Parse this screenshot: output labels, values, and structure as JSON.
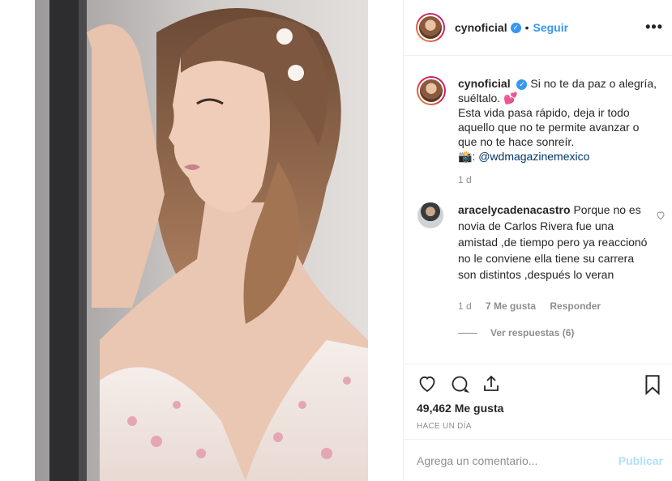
{
  "header": {
    "username": "cynoficial",
    "separator": "•",
    "follow_label": "Seguir",
    "more_icon": "more-horizontal-icon"
  },
  "caption": {
    "username": "cynoficial",
    "line1": "Si no te da paz o alegría, suéltalo.",
    "emoji": "💕",
    "line2": "Esta vida pasa rápido, deja ir todo aquello que no te permite avanzar o que no te hace sonreír.",
    "camera_emoji": "📸",
    "credit_prefix": ": ",
    "credit_handle": "@wdmagazinemexico",
    "time": "1 d"
  },
  "comment": {
    "username": "aracelycadenacastro",
    "text": "Porque no es novia de Carlos Rivera fue una amistad ,de tiempo pero ya reaccionó no le conviene ella tiene su carrera son distintos ,después lo veran",
    "time": "1 d",
    "likes": "7 Me gusta",
    "reply": "Responder",
    "view_replies": "Ver respuestas (6)"
  },
  "actions": {
    "likes": "49,462 Me gusta",
    "posted": "HACE UN DÍA"
  },
  "add_comment": {
    "placeholder": "Agrega un comentario...",
    "publish": "Publicar"
  },
  "colors": {
    "accent": "#3897f0",
    "publish_disabled": "#b2dffc",
    "muted": "#8e8e8e"
  }
}
